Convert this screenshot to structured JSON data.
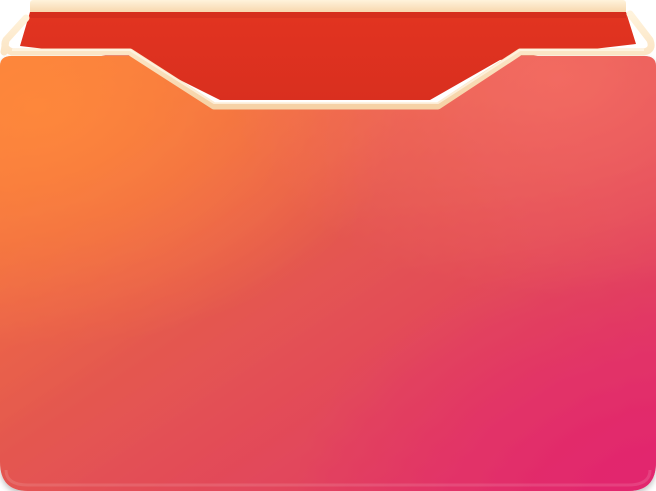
{
  "graphic": {
    "icon": "red-envelope-icon",
    "colors": {
      "inner_flap": "#e23420",
      "inner_flap_dark": "#c9281a",
      "trim_gold": "#fde7c4",
      "trim_gold_shadow": "#e9b98a",
      "body_top_left": "#fb7f3b",
      "body_top_right": "#f2645c",
      "body_center": "#e4584f",
      "body_bottom_left": "#d83d3a",
      "body_bottom_right": "#e0316b"
    }
  }
}
